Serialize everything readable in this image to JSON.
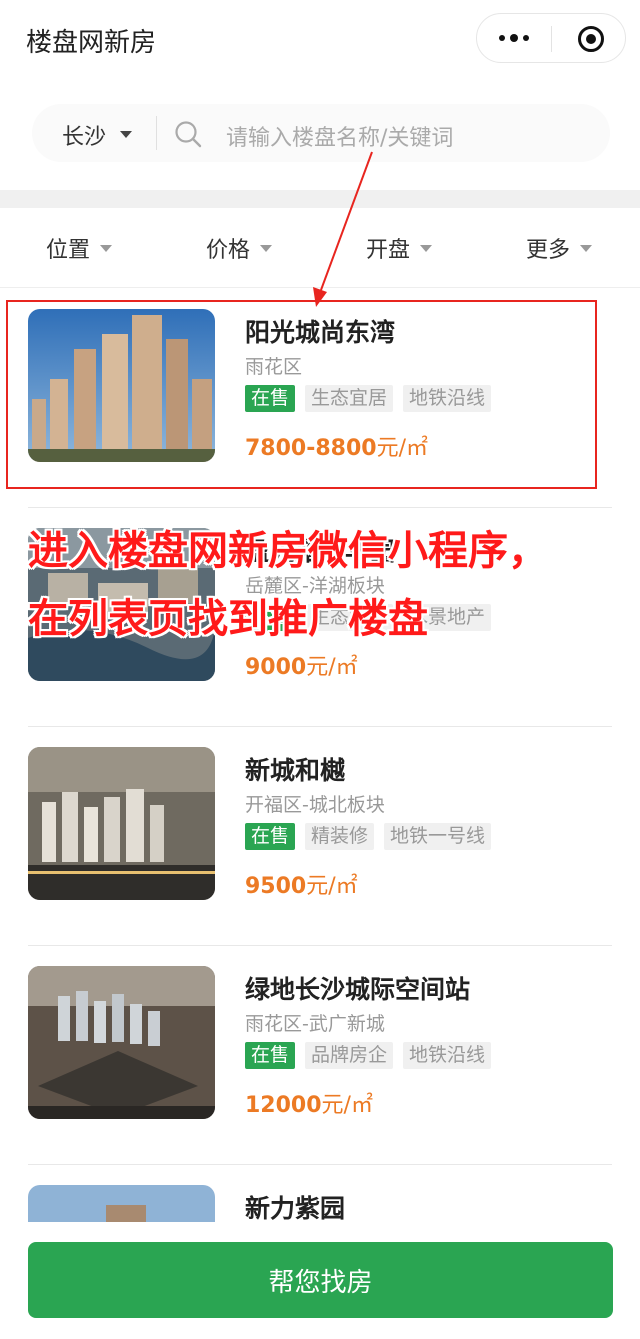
{
  "app": {
    "title": "楼盘网新房"
  },
  "search": {
    "city": "长沙",
    "placeholder": "请输入楼盘名称/关键词"
  },
  "filters": [
    "位置",
    "价格",
    "开盘",
    "更多"
  ],
  "listings": [
    {
      "name": "阳光城尚东湾",
      "area": "雨花区",
      "status": "在售",
      "tags": [
        "生态宜居",
        "地铁沿线"
      ],
      "price": "7800-8800",
      "unit": "元/㎡"
    },
    {
      "name": "盈光雍锦华园",
      "area": "岳麓区-洋湖板块",
      "status": "在售",
      "tags": [
        "生态宜居",
        "水景地产"
      ],
      "price": "9000",
      "unit": "元/㎡"
    },
    {
      "name": "新城和樾",
      "area": "开福区-城北板块",
      "status": "在售",
      "tags": [
        "精装修",
        "地铁一号线"
      ],
      "price": "9500",
      "unit": "元/㎡"
    },
    {
      "name": "绿地长沙城际空间站",
      "area": "雨花区-武广新城",
      "status": "在售",
      "tags": [
        "品牌房企",
        "地铁沿线"
      ],
      "price": "12000",
      "unit": "元/㎡"
    },
    {
      "name": "新力紫园",
      "area": "",
      "status": "",
      "tags": [],
      "price": "",
      "unit": ""
    }
  ],
  "annotation": {
    "line1": "进入楼盘网新房微信小程序，",
    "line2": "在列表页找到推广楼盘",
    "color": "#ff1a1a"
  },
  "bottom": {
    "button_label": "帮您找房"
  },
  "colors": {
    "brand_green": "#2aa552",
    "price_orange": "#ec7a24",
    "highlight_red": "#e8251f"
  }
}
